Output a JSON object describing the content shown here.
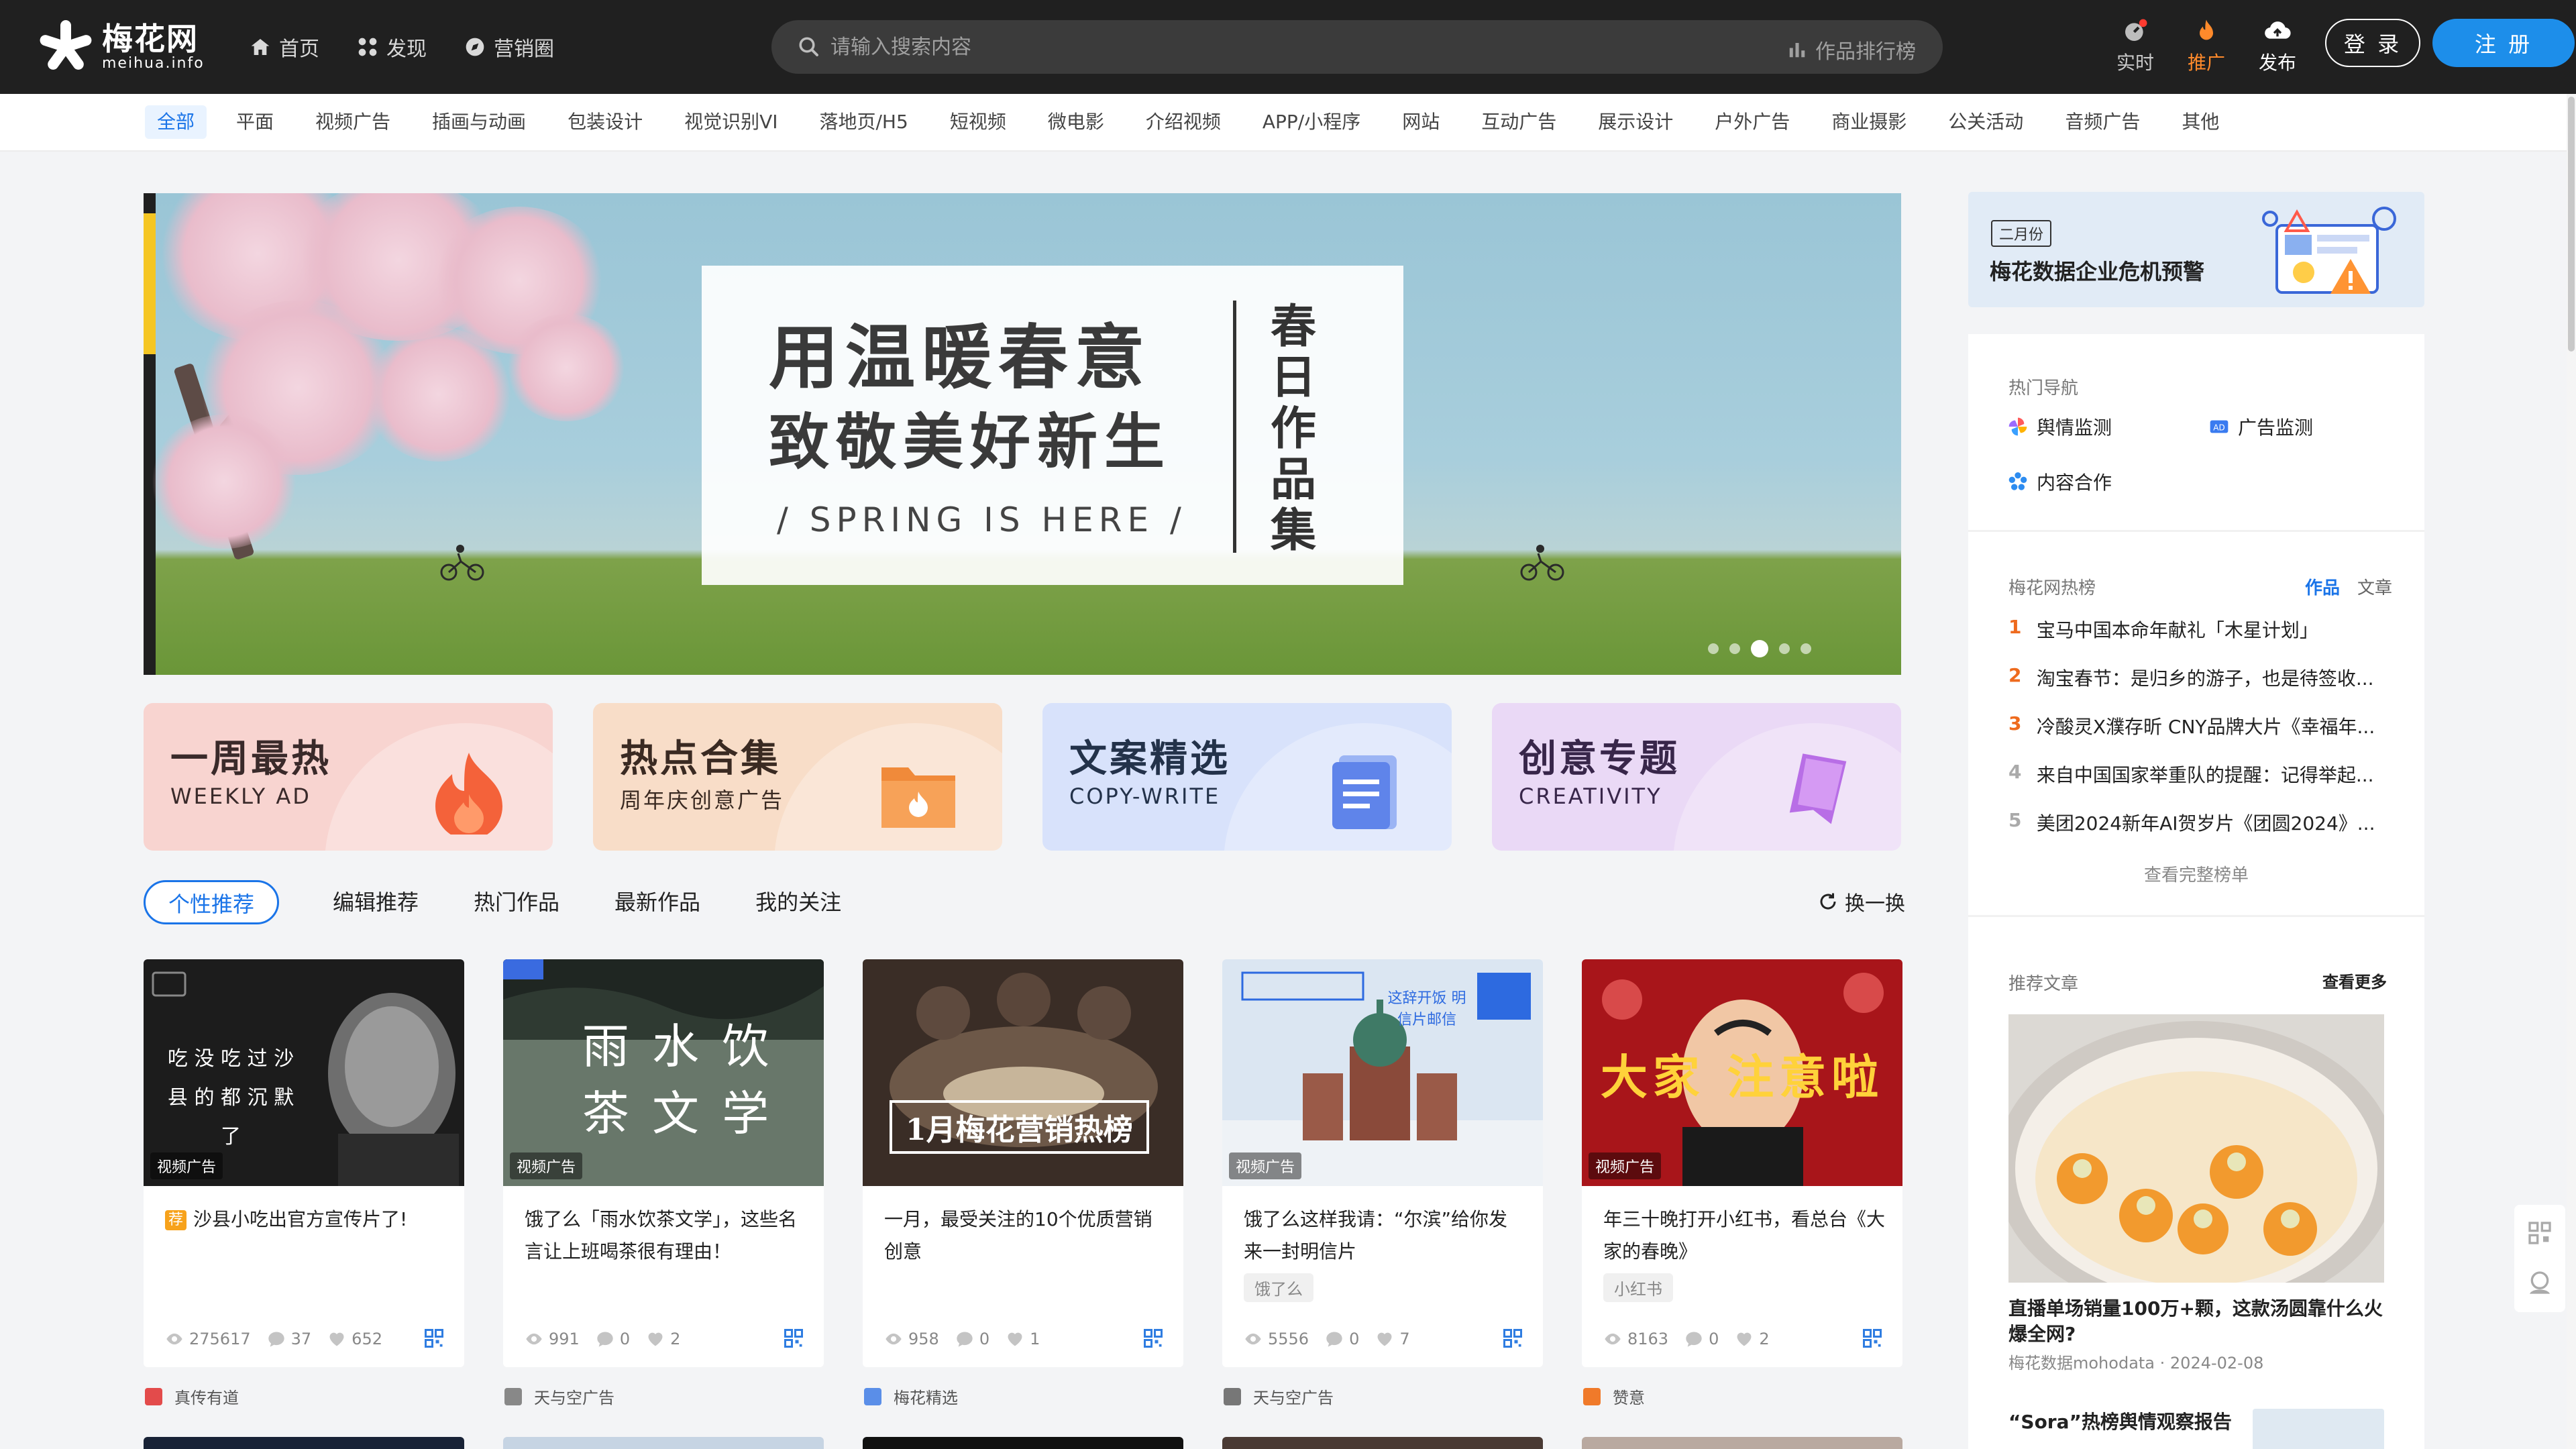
{
  "header": {
    "logo_cn": "梅花网",
    "logo_en": "meihua.info",
    "nav": [
      {
        "label": "首页",
        "icon": "home-icon"
      },
      {
        "label": "发现",
        "icon": "discover-icon"
      },
      {
        "label": "营销圈",
        "icon": "compass-icon"
      }
    ],
    "search_placeholder": "请输入搜索内容",
    "rank_label": "作品排行榜",
    "icons": [
      {
        "label": "实时",
        "icon": "realtime-icon"
      },
      {
        "label": "推广",
        "icon": "fire-icon"
      },
      {
        "label": "发布",
        "icon": "upload-cloud-icon"
      }
    ],
    "login": "登 录",
    "register": "注 册"
  },
  "categories": [
    "全部",
    "平面",
    "视频广告",
    "插画与动画",
    "包装设计",
    "视觉识别VI",
    "落地页/H5",
    "短视频",
    "微电影",
    "介绍视频",
    "APP/小程序",
    "网站",
    "互动广告",
    "展示设计",
    "户外广告",
    "商业摄影",
    "公关活动",
    "音频广告",
    "其他"
  ],
  "banner": {
    "line1": "用温暖春意",
    "line2": "致敬美好新生",
    "line3": "/ SPRING IS HERE /",
    "vertical": "春日作品集",
    "slides": 5,
    "active_slide": 3
  },
  "promos": [
    {
      "title": "一周最热",
      "subtitle": "WEEKLY AD",
      "bg": "#f8d4d0",
      "color": "#3a2a2a",
      "icon": "flame-icon"
    },
    {
      "title": "热点合集",
      "subtitle": "周年庆创意广告",
      "bg": "#f8ddc8",
      "color": "#3a2a22",
      "icon": "folder-icon"
    },
    {
      "title": "文案精选",
      "subtitle": "COPY-WRITE",
      "bg": "#d8e2fb",
      "color": "#23324a",
      "icon": "document-icon"
    },
    {
      "title": "创意专题",
      "subtitle": "CREATIVITY",
      "bg": "#ead9f6",
      "color": "#38264a",
      "icon": "bookmark-icon"
    }
  ],
  "tabs": [
    "个性推荐",
    "编辑推荐",
    "热门作品",
    "最新作品",
    "我的关注"
  ],
  "refresh": "换一换",
  "works": [
    {
      "badge": "视频广告",
      "title": "沙县小吃出官方宣传片了!",
      "title_prefix": "荐",
      "tag": "",
      "views": "275617",
      "comments": "37",
      "likes": "652",
      "author": "真传有道",
      "thumb_text": "吃 没 吃 过 沙 县 的  都 沉 默 了"
    },
    {
      "badge": "视频广告",
      "title": "饿了么「雨水饮茶文学」，这些名言让上班喝茶很有理由！",
      "tag": "",
      "views": "991",
      "comments": "0",
      "likes": "2",
      "author": "天与空广告",
      "thumb_text": "雨 水  饮 茶 文 学"
    },
    {
      "badge": "",
      "title": "一月，最受关注的10个优质营销创意",
      "tag": "",
      "views": "958",
      "comments": "0",
      "likes": "1",
      "author": "梅花精选",
      "thumb_text": "1月梅花营销热榜"
    },
    {
      "badge": "视频广告",
      "title": "饿了么这样我请：“尔滨”给你发来一封明信片",
      "tag": "饿了么",
      "views": "5556",
      "comments": "0",
      "likes": "7",
      "author": "天与空广告",
      "thumb_text": "这辞开饭 明信片邮信"
    },
    {
      "badge": "视频广告",
      "title": "年三十晚打开小红书，看总台《大家的春晚》",
      "tag": "小红书",
      "views": "8163",
      "comments": "0",
      "likes": "2",
      "author": "赞意",
      "thumb_text": "大家  注意啦"
    }
  ],
  "sidebar": {
    "ad_chip": "二月份",
    "ad_title": "梅花数据企业危机预警",
    "hot_nav_label": "热门导航",
    "hot_nav": [
      {
        "label": "舆情监测",
        "icon": "pinwheel-icon"
      },
      {
        "label": "广告监测",
        "icon": "ad-icon"
      },
      {
        "label": "内容合作",
        "icon": "flower-icon"
      }
    ],
    "hot_list_label": "梅花网热榜",
    "hot_switch": [
      "作品",
      "文章"
    ],
    "hot_list": [
      {
        "rank": "1",
        "text": "宝马中国本命年献礼「木星计划」"
      },
      {
        "rank": "2",
        "text": "淘宝春节：是归乡的游子，也是待签收..."
      },
      {
        "rank": "3",
        "text": "冷酸灵X濮存昕 CNY品牌大片《幸福年..."
      },
      {
        "rank": "4",
        "text": "来自中国国家举重队的提醒：记得举起..."
      },
      {
        "rank": "5",
        "text": "美团2024新年AI贺岁片《团圆2024》..."
      }
    ],
    "full_rank": "查看完整榜单",
    "articles_label": "推荐文章",
    "more": "查看更多",
    "article_title": "直播单场销量100万+颗，这款汤圆靠什么火爆全网?",
    "article_meta": "梅花数据mohodata · 2024-02-08",
    "article2_title": "“Sora”热榜舆情观察报告"
  },
  "colors": {
    "accent": "#1a74e8",
    "header_bg": "#202020",
    "hot_rank": "#ee6a1d"
  }
}
